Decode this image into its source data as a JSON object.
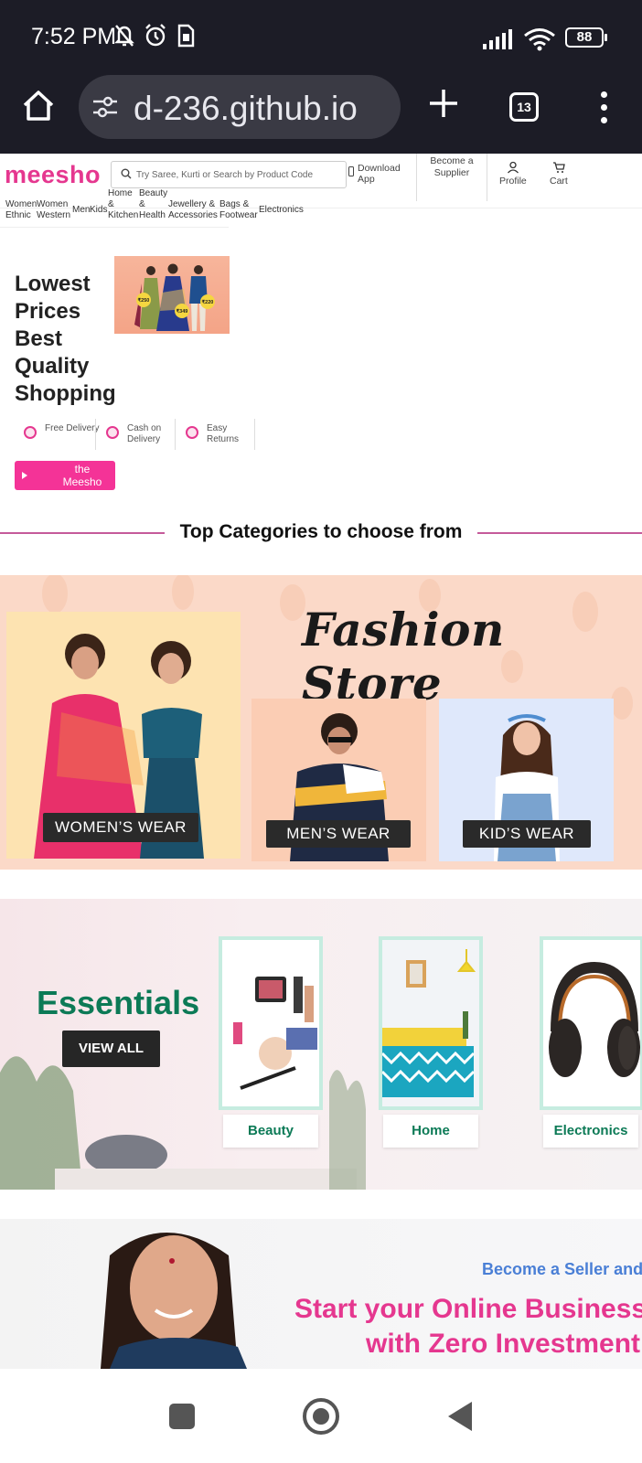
{
  "status_bar": {
    "time": "7:52 PM",
    "battery": "88"
  },
  "browser": {
    "url": "d-236.github.io",
    "tab_count": "13"
  },
  "header": {
    "logo": "meesho",
    "search_placeholder": "Try Saree, Kurti or Search by Product Code",
    "download_app": "Download App",
    "become_supplier": "Become a Supplier",
    "profile": "Profile",
    "cart": "Cart"
  },
  "nav_categories": [
    "Women Ethnic",
    "Women Western",
    "Men",
    "Kids",
    "Home & Kitchen",
    "Beauty & Health",
    "Jewellery & Accessories",
    "Bags & Footwear",
    "Electronics"
  ],
  "hero": {
    "title": "Lowest Prices Best Quality Shopping",
    "price_tags": [
      "₹250",
      "₹349",
      "₹220"
    ],
    "features": [
      "Free Delivery",
      "Cash on Delivery",
      "Easy Returns"
    ],
    "cta": "the Meesho"
  },
  "top_categories": {
    "heading": "Top Categories to choose from"
  },
  "fashion_store": {
    "title": "Fashion Store",
    "panels": [
      "WOMEN’S WEAR",
      "MEN’S WEAR",
      "KID’S WEAR"
    ]
  },
  "essentials": {
    "title": "Essentials",
    "view_all": "VIEW ALL",
    "cards": [
      "Beauty",
      "Home",
      "Electronics"
    ]
  },
  "seller_banner": {
    "subtitle": "Become a Seller and",
    "line1": "Start your Online Business",
    "line2": "with Zero Investment"
  },
  "colors": {
    "brand_pink": "#e5378f",
    "cta_pink": "#f43397",
    "essentials_green": "#0c7a56",
    "seller_blue": "#4a7fd6",
    "chrome_dark": "#1c1c26"
  }
}
